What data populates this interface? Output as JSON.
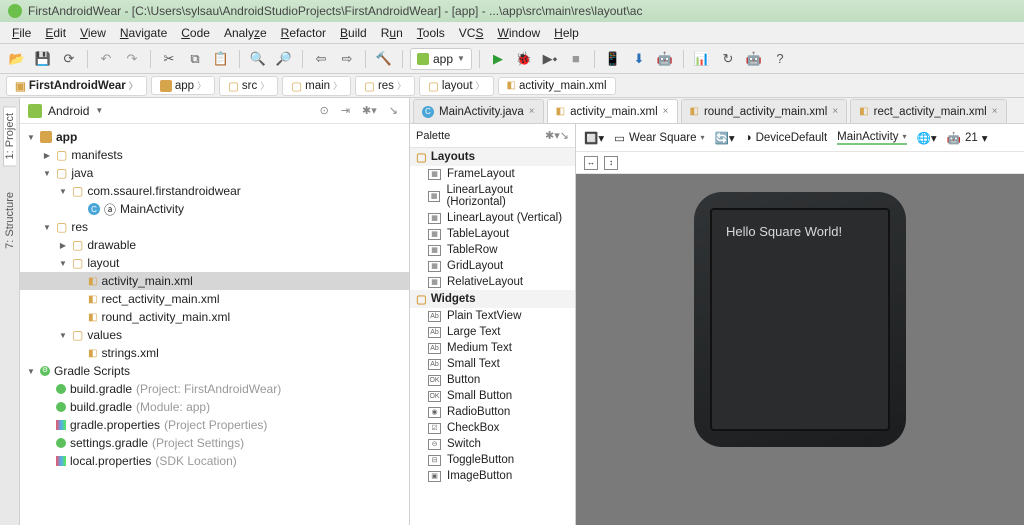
{
  "title": "FirstAndroidWear - [C:\\Users\\sylsau\\AndroidStudioProjects\\FirstAndroidWear] - [app] - ...\\app\\src\\main\\res\\layout\\ac",
  "menus": [
    "File",
    "Edit",
    "View",
    "Navigate",
    "Code",
    "Analyze",
    "Refactor",
    "Build",
    "Run",
    "Tools",
    "VCS",
    "Window",
    "Help"
  ],
  "module_selector": "app",
  "breadcrumbs": [
    "FirstAndroidWear",
    "app",
    "src",
    "main",
    "res",
    "layout",
    "activity_main.xml"
  ],
  "project_header": "Android",
  "side_tabs": [
    "1: Project",
    "7: Structure"
  ],
  "tree": {
    "app": "app",
    "manifests": "manifests",
    "java": "java",
    "pkg": "com.ssaurel.firstandroidwear",
    "main_activity": "MainActivity",
    "res": "res",
    "drawable": "drawable",
    "layout": "layout",
    "activity_main": "activity_main.xml",
    "rect_activity": "rect_activity_main.xml",
    "round_activity": "round_activity_main.xml",
    "values": "values",
    "strings": "strings.xml",
    "gradle_scripts": "Gradle Scripts",
    "bg_project": {
      "name": "build.gradle",
      "note": "(Project: FirstAndroidWear)"
    },
    "bg_module": {
      "name": "build.gradle",
      "note": "(Module: app)"
    },
    "gradle_props": {
      "name": "gradle.properties",
      "note": "(Project Properties)"
    },
    "settings_gradle": {
      "name": "settings.gradle",
      "note": "(Project Settings)"
    },
    "local_props": {
      "name": "local.properties",
      "note": "(SDK Location)"
    }
  },
  "file_tabs": [
    {
      "name": "MainActivity.java",
      "icon": "c"
    },
    {
      "name": "activity_main.xml",
      "icon": "xml",
      "active": true
    },
    {
      "name": "round_activity_main.xml",
      "icon": "xml"
    },
    {
      "name": "rect_activity_main.xml",
      "icon": "xml"
    }
  ],
  "palette_header": "Palette",
  "palette_groups": [
    {
      "title": "Layouts",
      "items": [
        "FrameLayout",
        "LinearLayout (Horizontal)",
        "LinearLayout (Vertical)",
        "TableLayout",
        "TableRow",
        "GridLayout",
        "RelativeLayout"
      ]
    },
    {
      "title": "Widgets",
      "items": [
        "Plain TextView",
        "Large Text",
        "Medium Text",
        "Small Text",
        "Button",
        "Small Button",
        "RadioButton",
        "CheckBox",
        "Switch",
        "ToggleButton",
        "ImageButton"
      ]
    }
  ],
  "designer_toolbar": {
    "device": "Wear Square",
    "theme": "DeviceDefault",
    "activity": "MainActivity",
    "api": "21"
  },
  "preview_text": "Hello Square World!"
}
